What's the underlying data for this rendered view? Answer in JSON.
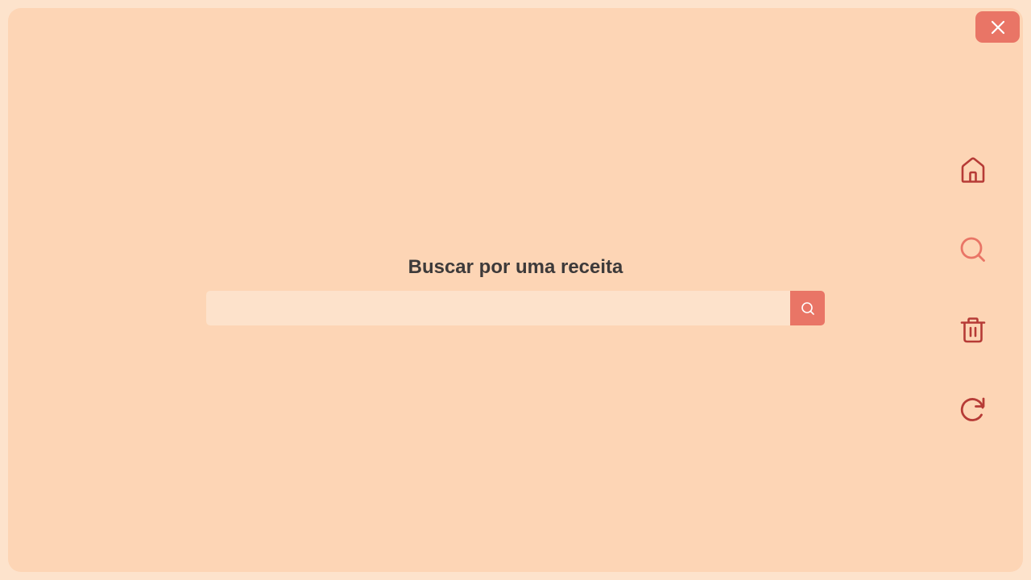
{
  "search": {
    "title": "Buscar por uma receita",
    "placeholder": "",
    "value": ""
  },
  "icons": {
    "close": "close-icon",
    "search_submit": "search-icon",
    "nav": [
      "home-icon",
      "search-icon",
      "trash-icon",
      "refresh-icon"
    ]
  },
  "colors": {
    "page_border": "#fde3cc",
    "background": "#fdd5b5",
    "input_background": "#fde2cb",
    "accent": "#e97566",
    "nav_icon": "#b63b36",
    "nav_icon_active": "#e97566",
    "title_text": "#3d3a3a"
  }
}
